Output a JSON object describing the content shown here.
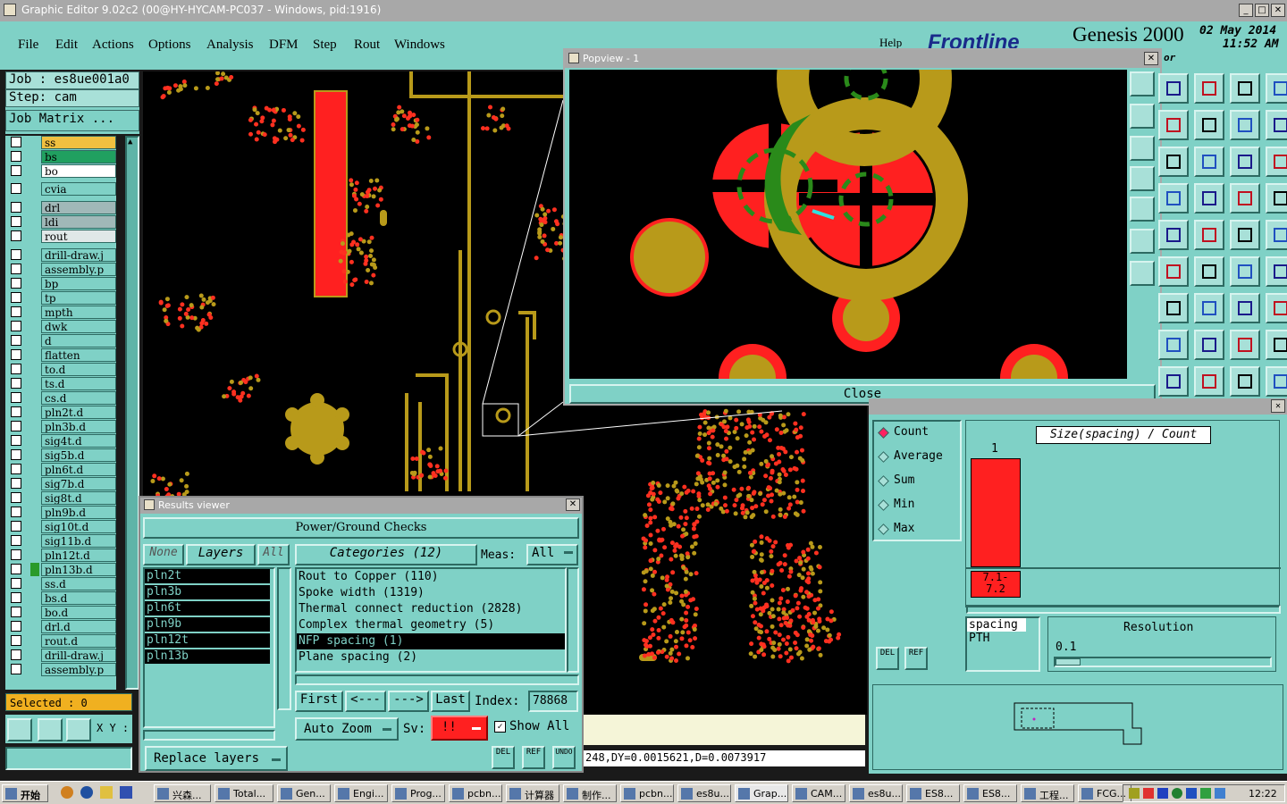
{
  "window": {
    "title": "Graphic Editor 9.02c2 (00@HY-HYCAM-PC037 - Windows, pid:1916)"
  },
  "menu": [
    "File",
    "Edit",
    "Actions",
    "Options",
    "Analysis",
    "DFM",
    "Step",
    "Rout",
    "Windows"
  ],
  "help_label": "Help",
  "brand": {
    "logo": "Frontline",
    "product": "Genesis 2000",
    "date": "02 May 2014",
    "time": "11:52 AM",
    "sub": "or"
  },
  "job": {
    "job_label": "Job  :  es8ue001a0",
    "step_label": "Step:  cam",
    "matrix_button": "Job Matrix ..."
  },
  "layers": [
    {
      "name": "ss",
      "color": "#f0c040",
      "mark": "⬋"
    },
    {
      "name": "bs",
      "color": "#20a060",
      "mark": "⬋"
    },
    {
      "name": "bo",
      "color": "#ffffff",
      "mark": ""
    },
    {
      "name": "cvia",
      "color": "",
      "mark": ""
    },
    {
      "name": "drl",
      "color": "#a0b8b8",
      "mark": ""
    },
    {
      "name": "ldi",
      "color": "#a0b8b8",
      "mark": ""
    },
    {
      "name": "rout",
      "color": "#e0e8e8",
      "mark": ""
    },
    {
      "name": "drill-draw.j",
      "color": "",
      "mark": ""
    },
    {
      "name": "assembly.p",
      "color": "",
      "mark": "⬋"
    },
    {
      "name": "bp",
      "color": "",
      "mark": ""
    },
    {
      "name": "tp",
      "color": "",
      "mark": ""
    },
    {
      "name": "mpth",
      "color": "",
      "mark": ""
    },
    {
      "name": "dwk",
      "color": "",
      "mark": ""
    },
    {
      "name": "d",
      "color": "",
      "mark": ""
    },
    {
      "name": "flatten",
      "color": "",
      "mark": ""
    },
    {
      "name": "to.d",
      "color": "",
      "mark": "⬋"
    },
    {
      "name": "ts.d",
      "color": "",
      "mark": "⬋"
    },
    {
      "name": "cs.d",
      "color": "",
      "mark": "⬋"
    },
    {
      "name": "pln2t.d",
      "color": "",
      "mark": "⬋"
    },
    {
      "name": "pln3b.d",
      "color": "",
      "mark": "⬋"
    },
    {
      "name": "sig4t.d",
      "color": "",
      "mark": "⬋"
    },
    {
      "name": "sig5b.d",
      "color": "",
      "mark": "⬋"
    },
    {
      "name": "pln6t.d",
      "color": "",
      "mark": "⬋"
    },
    {
      "name": "sig7b.d",
      "color": "",
      "mark": "⬋"
    },
    {
      "name": "sig8t.d",
      "color": "",
      "mark": "⬋"
    },
    {
      "name": "pln9b.d",
      "color": "",
      "mark": "⬋"
    },
    {
      "name": "sig10t.d",
      "color": "",
      "mark": "⬋"
    },
    {
      "name": "sig11b.d",
      "color": "",
      "mark": "⬋"
    },
    {
      "name": "pln12t.d",
      "color": "",
      "mark": "⬋"
    },
    {
      "name": "pln13b.d",
      "color": "",
      "mark": "⬋"
    },
    {
      "name": "ss.d",
      "color": "",
      "mark": "⬋"
    },
    {
      "name": "bs.d",
      "color": "",
      "mark": "⬋"
    },
    {
      "name": "bo.d",
      "color": "",
      "mark": ""
    },
    {
      "name": "drl.d",
      "color": "",
      "mark": ""
    },
    {
      "name": "rout.d",
      "color": "",
      "mark": ""
    },
    {
      "name": "drill-draw.j",
      "color": "",
      "mark": ""
    },
    {
      "name": "assembly.p",
      "color": "",
      "mark": ""
    }
  ],
  "selected_label": "Selected : 0",
  "xy_label": "X Y :",
  "popview": {
    "title": "Popview - 1",
    "close_label": "Close"
  },
  "results": {
    "title": "Results viewer",
    "header": "Power/Ground Checks",
    "none_label": "None",
    "layers_label": "Layers",
    "all_label": "All",
    "categories_label": "Categories (12)",
    "meas_label": "Meas:",
    "meas_value": "All",
    "layer_items": [
      "pln2t",
      "pln3b",
      "pln6t",
      "pln9b",
      "pln12t",
      "pln13b"
    ],
    "categories": [
      "Rout to Copper (110)",
      "Spoke width (1319)",
      "Thermal connect reduction (2828)",
      "Complex thermal geometry (5)",
      "NFP spacing (1)",
      "Plane spacing (2)"
    ],
    "selected_category": 4,
    "first_label": "First",
    "prev_label": "<---",
    "next_label": "--->",
    "last_label": "Last",
    "index_label": "Index:",
    "index_value": "78868",
    "autozoom_label": "Auto Zoom",
    "sv_label": "Sv:",
    "sv_value": "!!",
    "showall_label": "Show All",
    "replace_label": "Replace layers",
    "del_label": "DEL",
    "ref_label": "REF",
    "undo_label": "UNDO"
  },
  "status_line": "248,DY=0.0015621,D=0.0073917",
  "stats": {
    "options": [
      "Count",
      "Average",
      "Sum",
      "Min",
      "Max"
    ],
    "selected_option": 0,
    "chart_title": "Size(spacing) / Count",
    "bar_count": "1",
    "bar_label": "7.1-\n7.2",
    "bar_label_line1": "7.1-",
    "bar_label_line2": "7.2",
    "list_items": [
      "spacing",
      "PTH"
    ],
    "resolution_label": "Resolution",
    "resolution_value": "0.1",
    "del_label": "DEL",
    "ref_label": "REF"
  },
  "taskbar": {
    "start": "开始",
    "clock": "12:22",
    "tasks": [
      "兴森...",
      "Total...",
      "Gen...",
      "Engi...",
      "Prog...",
      "pcbn...",
      "计算器",
      "制作...",
      "pcbn...",
      "es8u...",
      "Grap...",
      "CAM...",
      "es8u...",
      "ES8...",
      "ES8...",
      "工程...",
      "FCG..."
    ]
  },
  "colors": {
    "teal": "#7fd1c6",
    "red": "#ff2020",
    "gold": "#b89a1a",
    "green": "#2a8a1a",
    "black": "#000000"
  }
}
